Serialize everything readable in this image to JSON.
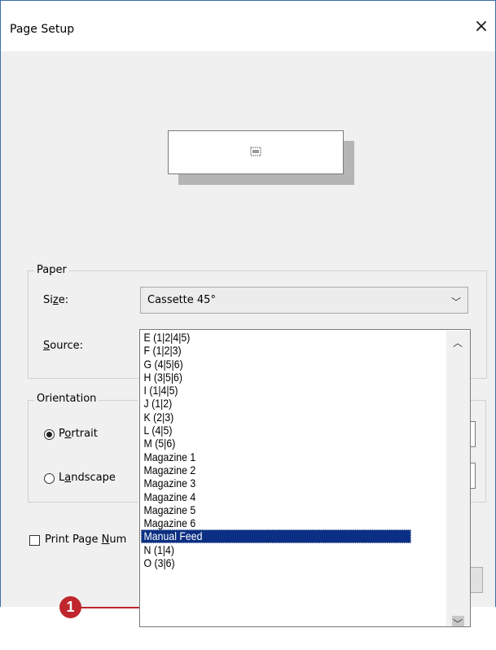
{
  "dialog": {
    "title": "Page Setup",
    "close_glyph": "×"
  },
  "paper": {
    "legend": "Paper",
    "size_label_pre": "Si",
    "size_label_key": "z",
    "size_label_post": "e:",
    "size_value": "Cassette 45°",
    "source_label_key": "S",
    "source_label_post": "ource:"
  },
  "source_list": {
    "items": [
      "E (1|2|4|5)",
      "F (1|2|3)",
      "G (4|5|6)",
      "H (3|5|6)",
      "I (1|4|5)",
      "J (1|2)",
      "K (2|3)",
      "L (4|5)",
      "M (5|6)",
      "Magazine 1",
      "Magazine 2",
      "Magazine 3",
      "Magazine 4",
      "Magazine 5",
      "Magazine 6",
      "Manual Feed",
      "N (1|4)",
      "O (3|6)"
    ],
    "selected": "Manual Feed"
  },
  "orientation": {
    "legend": "Orientation",
    "portrait_pre": "P",
    "portrait_key": "o",
    "portrait_post": "rtrait",
    "landscape_pre": "L",
    "landscape_key": "a",
    "landscape_post": "ndscape",
    "selected": "Portrait"
  },
  "print_page_numbers": {
    "pre": "Print Page ",
    "key": "N",
    "post": "um",
    "checked": false
  },
  "callout": {
    "number": "1",
    "color": "#c0272d"
  },
  "colors": {
    "selection": "#0b2f82",
    "dialog_bg": "#f0f0f0"
  }
}
